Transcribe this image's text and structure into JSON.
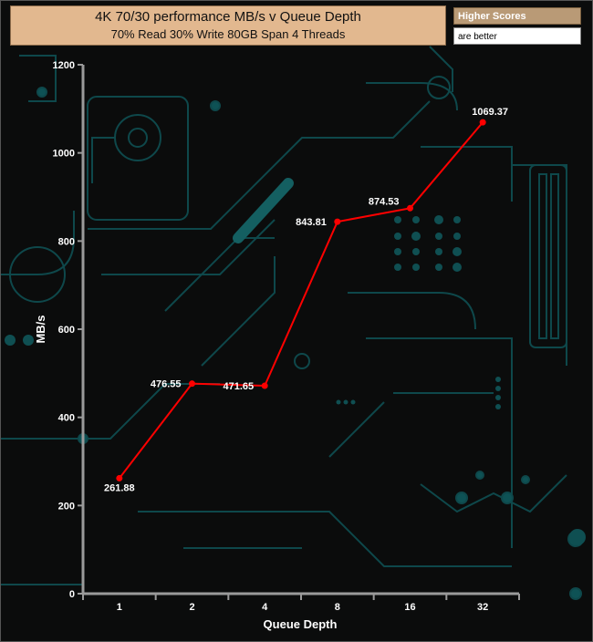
{
  "header": {
    "title": "4K 70/30 performance MB/s v Queue Depth",
    "subtitle": "70% Read 30% Write 80GB Span 4 Threads"
  },
  "legend": {
    "line1": "Higher Scores",
    "line2": "are better"
  },
  "colors": {
    "series": "#ff0000",
    "axis": "#9a9a9a",
    "title_bg": "#e2b88f",
    "circuit": "#0f5a5e"
  },
  "chart_data": {
    "type": "line",
    "title": "4K 70/30 performance MB/s v Queue Depth",
    "subtitle": "70% Read 30% Write 80GB Span 4 Threads",
    "xlabel": "Queue Depth",
    "ylabel": "MB/s",
    "categories": [
      "1",
      "2",
      "4",
      "8",
      "16",
      "32"
    ],
    "ylim": [
      0,
      1200
    ],
    "yticks": [
      0,
      200,
      400,
      600,
      800,
      1000,
      1200
    ],
    "series": [
      {
        "values": [
          261.88,
          476.55,
          471.65,
          843.81,
          874.53,
          1069.37
        ],
        "labels": [
          "261.88",
          "476.55",
          "471.65",
          "843.81",
          "874.53",
          "1069.37"
        ]
      }
    ],
    "grid": false,
    "legend": "none"
  }
}
